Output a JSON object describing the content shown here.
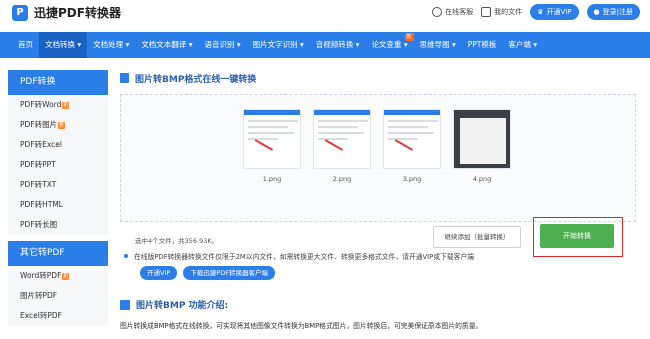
{
  "header": {
    "logo_text": "迅捷PDF转换器",
    "service": "在线客服",
    "my_files": "我的文件",
    "vip": "开通VIP",
    "login": "登录|注册"
  },
  "nav": {
    "items": [
      {
        "label": "首页",
        "active": false
      },
      {
        "label": "文档转换 ▾",
        "active": true
      },
      {
        "label": "文档处理 ▾",
        "active": false
      },
      {
        "label": "文档文本翻译 ▾",
        "active": false
      },
      {
        "label": "语音识别 ▾",
        "active": false
      },
      {
        "label": "图片文字识别 ▾",
        "active": false
      },
      {
        "label": "音视频转换 ▾",
        "active": false
      },
      {
        "label": "论文查重 ▾",
        "active": false,
        "badge": "新"
      },
      {
        "label": "思维导图 ▾",
        "active": false
      },
      {
        "label": "PPT模板",
        "active": false
      },
      {
        "label": "客户端 ▾",
        "active": false
      }
    ]
  },
  "sidebar": {
    "section1": "PDF转换",
    "items1": [
      {
        "label": "PDF转Word",
        "badge": "折"
      },
      {
        "label": "PDF转图片",
        "badge": "折"
      },
      {
        "label": "PDF转Excel"
      },
      {
        "label": "PDF转PPT"
      },
      {
        "label": "PDF转TXT"
      },
      {
        "label": "PDF转HTML"
      },
      {
        "label": "PDF转长图"
      }
    ],
    "section2": "其它转PDF",
    "items2": [
      {
        "label": "Word转PDF",
        "badge": "折"
      },
      {
        "label": "图片转PDF"
      },
      {
        "label": "Excel转PDF"
      }
    ]
  },
  "main": {
    "title": "图片转BMP格式在线一键转换",
    "files": [
      "1.png",
      "2.png",
      "3.png",
      "4.png"
    ],
    "file_info": "选中4个文件，共356.93K。",
    "add_btn": "继续添加（批量转换）",
    "start_btn": "开始转换",
    "notice": "在线版PDF转换器转换文件仅限于2M以内文件，如需转换更大文件、转换更多格式文件，请开通VIP或下载客户端",
    "vip_pill": "开通VIP",
    "download_pill": "下载迅捷PDF转换器客户端",
    "intro_title": "图片转BMP 功能介绍:",
    "intro_text": "图片转换成BMP格式在线转换，可实现将其他图像文件转换为BMP格式图片，图片转换后，可完美保证原本图片的质量。"
  },
  "colors": {
    "primary": "#2b7ee8",
    "active_nav": "#1a62c4",
    "start": "#4caf50",
    "highlight": "#e0262a"
  }
}
